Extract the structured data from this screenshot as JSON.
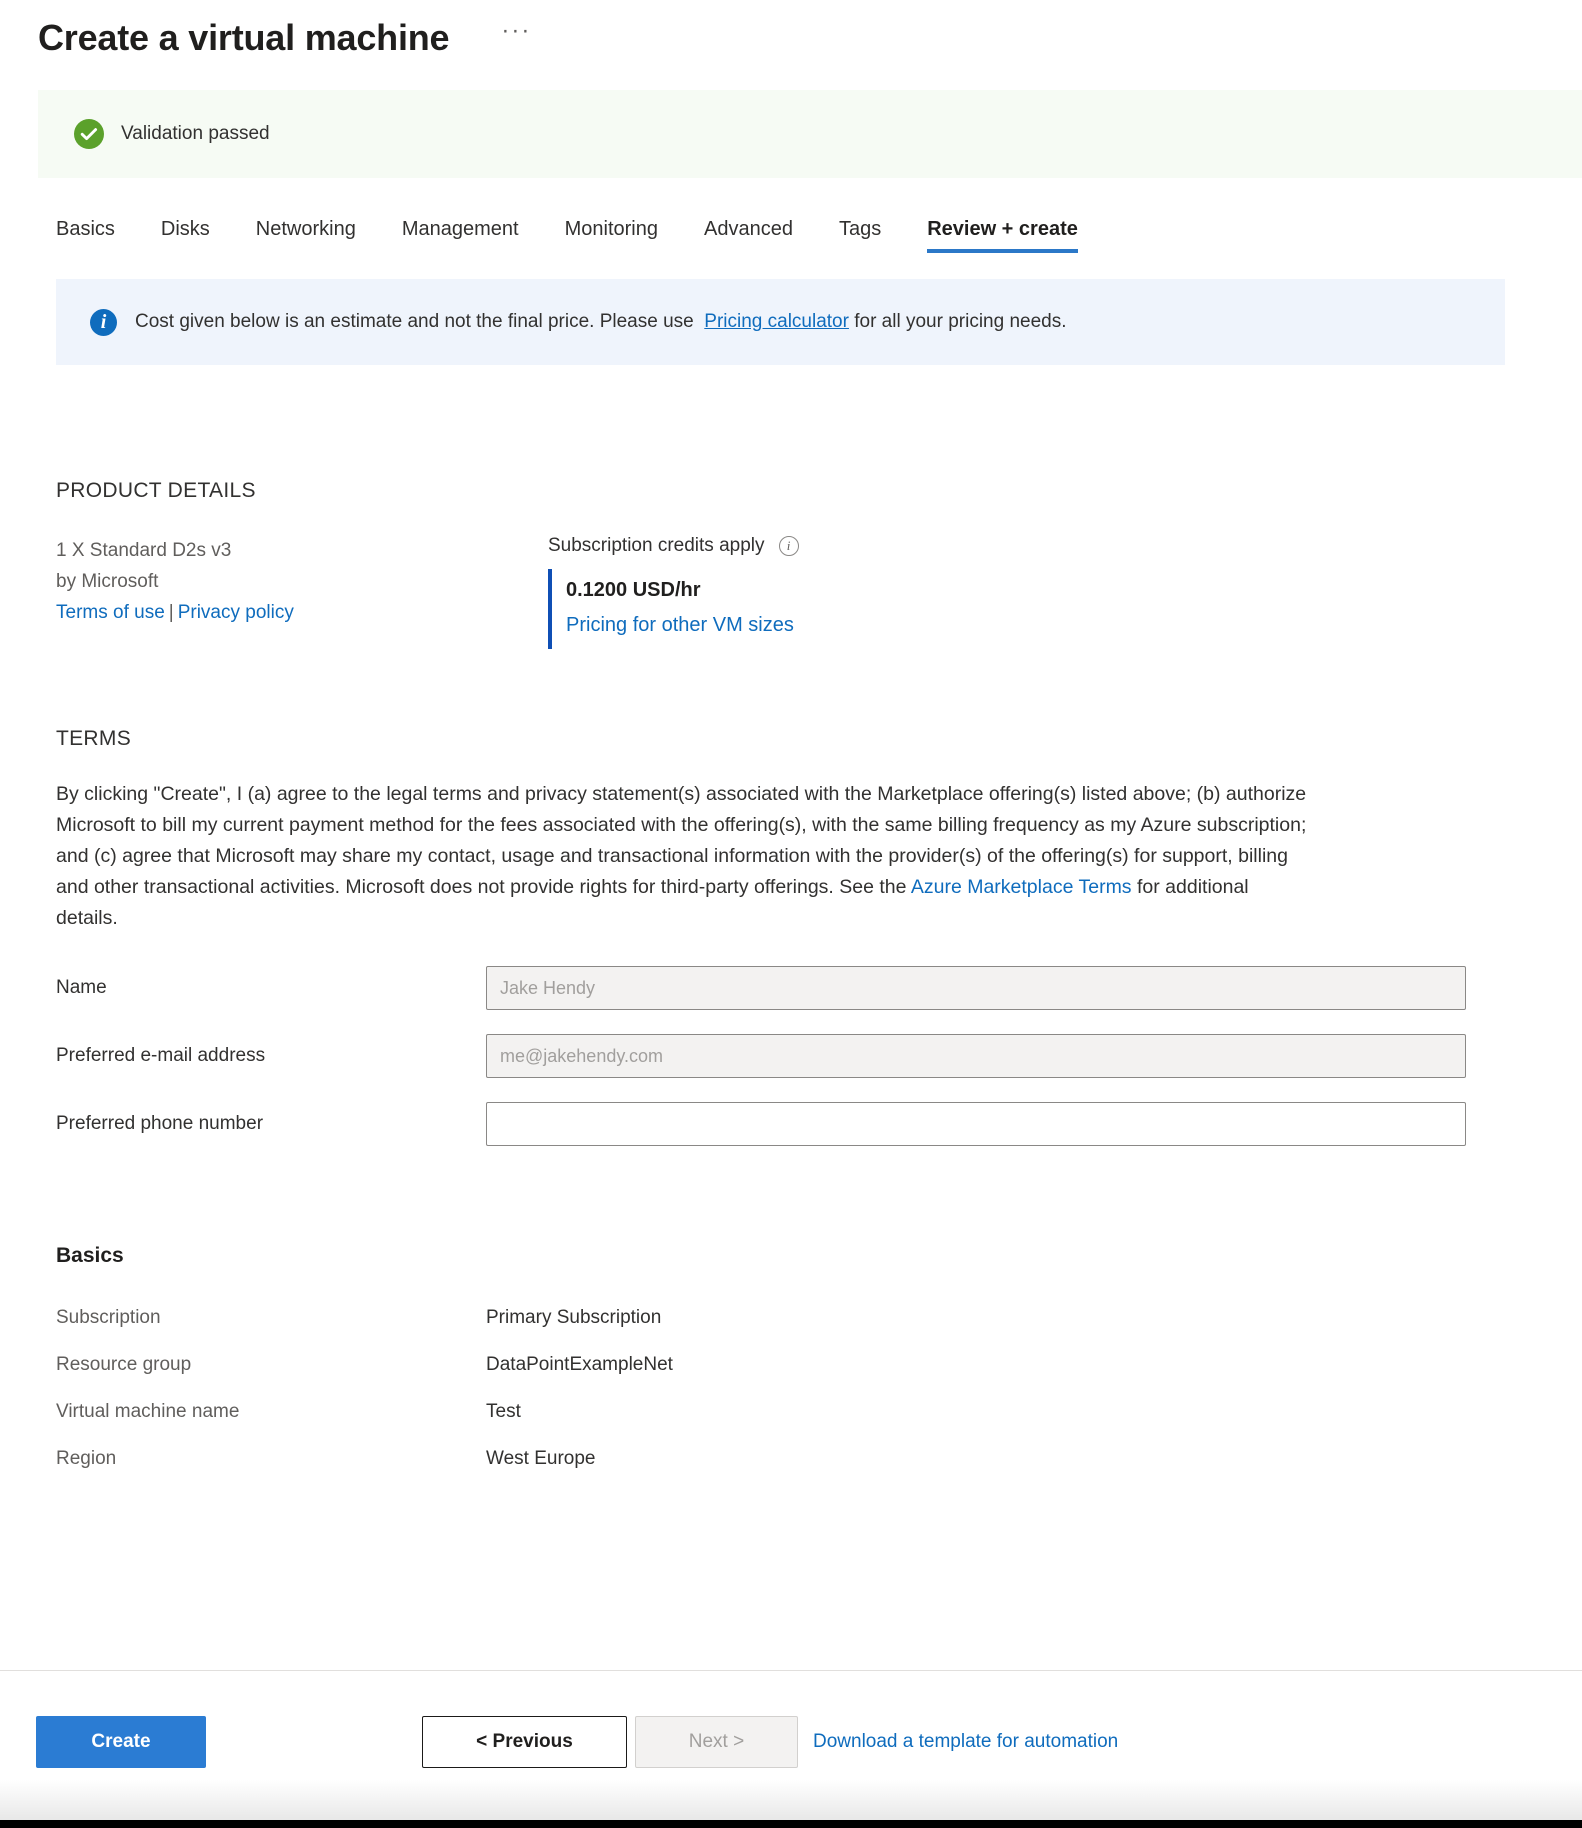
{
  "header": {
    "title": "Create a virtual machine",
    "more_label": "···"
  },
  "validation": {
    "text": "Validation passed",
    "status_color": "#5ba12b",
    "background": "#f6fbf4"
  },
  "tabs": [
    {
      "label": "Basics",
      "active": false
    },
    {
      "label": "Disks",
      "active": false
    },
    {
      "label": "Networking",
      "active": false
    },
    {
      "label": "Management",
      "active": false
    },
    {
      "label": "Monitoring",
      "active": false
    },
    {
      "label": "Advanced",
      "active": false
    },
    {
      "label": "Tags",
      "active": false
    },
    {
      "label": "Review + create",
      "active": true
    }
  ],
  "info_banner": {
    "text_before": "Cost given below is an estimate and not the final price. Please use",
    "link_label": "Pricing calculator",
    "text_after": "for all your pricing needs.",
    "background": "#eff4fc",
    "icon": "info-icon"
  },
  "product_details": {
    "heading": "PRODUCT DETAILS",
    "sku": "1 X Standard D2s v3",
    "publisher": "by Microsoft",
    "terms_of_use_label": "Terms of use",
    "separator": "|",
    "privacy_policy_label": "Privacy policy",
    "credits_label": "Subscription credits apply",
    "price": "0.1200 USD/hr",
    "pricing_link_label": "Pricing for other VM sizes",
    "accent_color": "#0f4fb5"
  },
  "terms": {
    "heading": "TERMS",
    "body_before_link": "By clicking \"Create\", I (a) agree to the legal terms and privacy statement(s) associated with the Marketplace offering(s) listed above; (b) authorize Microsoft to bill my current payment method for the fees associated with the offering(s), with the same billing frequency as my Azure subscription; and (c) agree that Microsoft may share my contact, usage and transactional information with the provider(s) of the offering(s) for support, billing and other transactional activities. Microsoft does not provide rights for third-party offerings. See the ",
    "link_label": "Azure Marketplace Terms",
    "body_after_link": " for additional details."
  },
  "form": {
    "fields": [
      {
        "label": "Name",
        "value": "",
        "placeholder": "Jake Hendy",
        "readonly": true
      },
      {
        "label": "Preferred e-mail address",
        "value": "",
        "placeholder": "me@jakehendy.com",
        "readonly": true
      },
      {
        "label": "Preferred phone number",
        "value": "",
        "placeholder": "",
        "readonly": false
      }
    ]
  },
  "basics": {
    "heading": "Basics",
    "rows": [
      {
        "key": "Subscription",
        "value": "Primary Subscription"
      },
      {
        "key": "Resource group",
        "value": "DataPointExampleNet"
      },
      {
        "key": "Virtual machine name",
        "value": "Test"
      },
      {
        "key": "Region",
        "value": "West Europe"
      }
    ]
  },
  "footer": {
    "create_label": "Create",
    "previous_label": "< Previous",
    "next_label": "Next >",
    "download_label": "Download a template for automation",
    "primary_color": "#2b7cd3"
  }
}
